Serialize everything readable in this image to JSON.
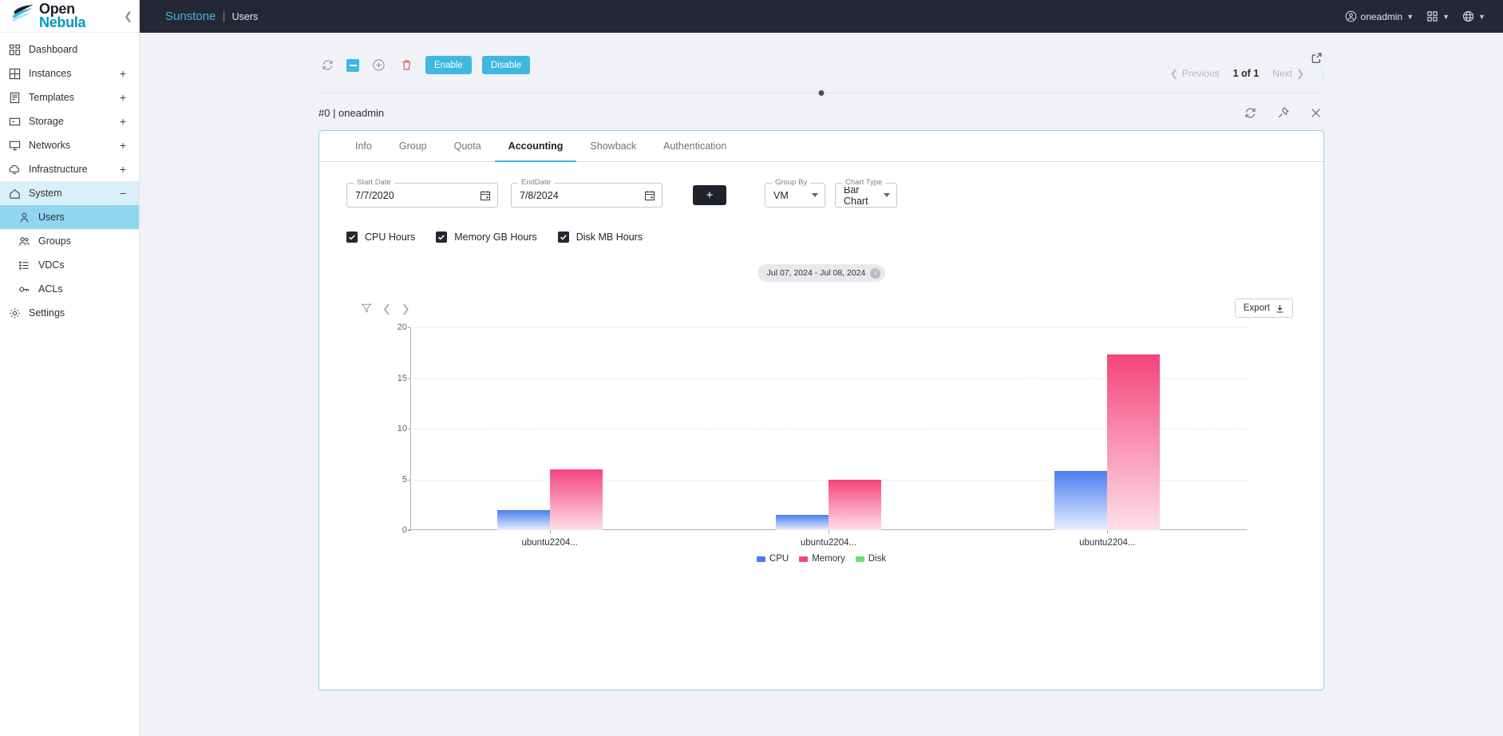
{
  "brand": {
    "line1": "Open",
    "line2": "Nebula",
    "collapse_icon": "chevron-left-icon"
  },
  "sidebar": {
    "items": [
      {
        "label": "Dashboard",
        "icon": "dashboard-icon",
        "expand": ""
      },
      {
        "label": "Instances",
        "icon": "instances-icon",
        "expand": "+"
      },
      {
        "label": "Templates",
        "icon": "templates-icon",
        "expand": "+"
      },
      {
        "label": "Storage",
        "icon": "storage-icon",
        "expand": "+"
      },
      {
        "label": "Networks",
        "icon": "networks-icon",
        "expand": "+"
      },
      {
        "label": "Infrastructure",
        "icon": "infrastructure-icon",
        "expand": "+"
      },
      {
        "label": "System",
        "icon": "system-icon",
        "expand": "−"
      },
      {
        "label": "Users",
        "icon": "user-icon",
        "expand": ""
      },
      {
        "label": "Groups",
        "icon": "groups-icon",
        "expand": ""
      },
      {
        "label": "VDCs",
        "icon": "list-icon",
        "expand": ""
      },
      {
        "label": "ACLs",
        "icon": "key-icon",
        "expand": ""
      },
      {
        "label": "Settings",
        "icon": "gear-icon",
        "expand": ""
      }
    ]
  },
  "topbar": {
    "app_name": "Sunstone",
    "separator": "|",
    "page": "Users",
    "user": "oneadmin",
    "accent": "#3fb8e0"
  },
  "toolbar": {
    "refresh_label": "refresh-icon",
    "select_label": "select-icon",
    "add_label": "add-icon",
    "delete_label": "delete-icon",
    "enable_label": "Enable",
    "disable_label": "Disable",
    "previous_label": "Previous",
    "page_indicator": "1 of 1",
    "next_label": "Next"
  },
  "detail": {
    "title": "#0 | oneadmin",
    "tabs": [
      {
        "label": "Info",
        "active": false
      },
      {
        "label": "Group",
        "active": false
      },
      {
        "label": "Quota",
        "active": false
      },
      {
        "label": "Accounting",
        "active": true
      },
      {
        "label": "Showback",
        "active": false
      },
      {
        "label": "Authentication",
        "active": false
      }
    ]
  },
  "accounting": {
    "start_date": {
      "legend": "Start Date",
      "value": "7/7/2020"
    },
    "end_date": {
      "legend": "EndDate",
      "value": "7/8/2024"
    },
    "add_button": "+",
    "group_by": {
      "legend": "Group By",
      "value": "VM"
    },
    "chart_type": {
      "legend": "Chart Type",
      "value": "Bar Chart"
    },
    "checkboxes": [
      {
        "label": "CPU Hours",
        "checked": true
      },
      {
        "label": "Memory GB Hours",
        "checked": true
      },
      {
        "label": "Disk MB Hours",
        "checked": true
      }
    ],
    "chip": {
      "label": "Jul 07, 2024 - Jul 08, 2024",
      "close": "×"
    },
    "export_label": "Export"
  },
  "chart_data": {
    "type": "bar",
    "title": "",
    "xlabel": "",
    "ylabel": "",
    "ylim": [
      0,
      20
    ],
    "yticks": [
      20,
      15,
      10,
      5,
      0
    ],
    "grid": true,
    "legend_position": "bottom",
    "categories": [
      "ubuntu2204...",
      "ubuntu2204...",
      "ubuntu2204..."
    ],
    "series": [
      {
        "name": "CPU",
        "color": "#4a7ef0",
        "values": [
          2.0,
          1.5,
          5.8
        ]
      },
      {
        "name": "Memory",
        "color": "#f5447c",
        "values": [
          6.0,
          5.0,
          17.3
        ]
      },
      {
        "name": "Disk",
        "color": "#6ee06e",
        "values": [
          0,
          0,
          0
        ]
      }
    ]
  }
}
